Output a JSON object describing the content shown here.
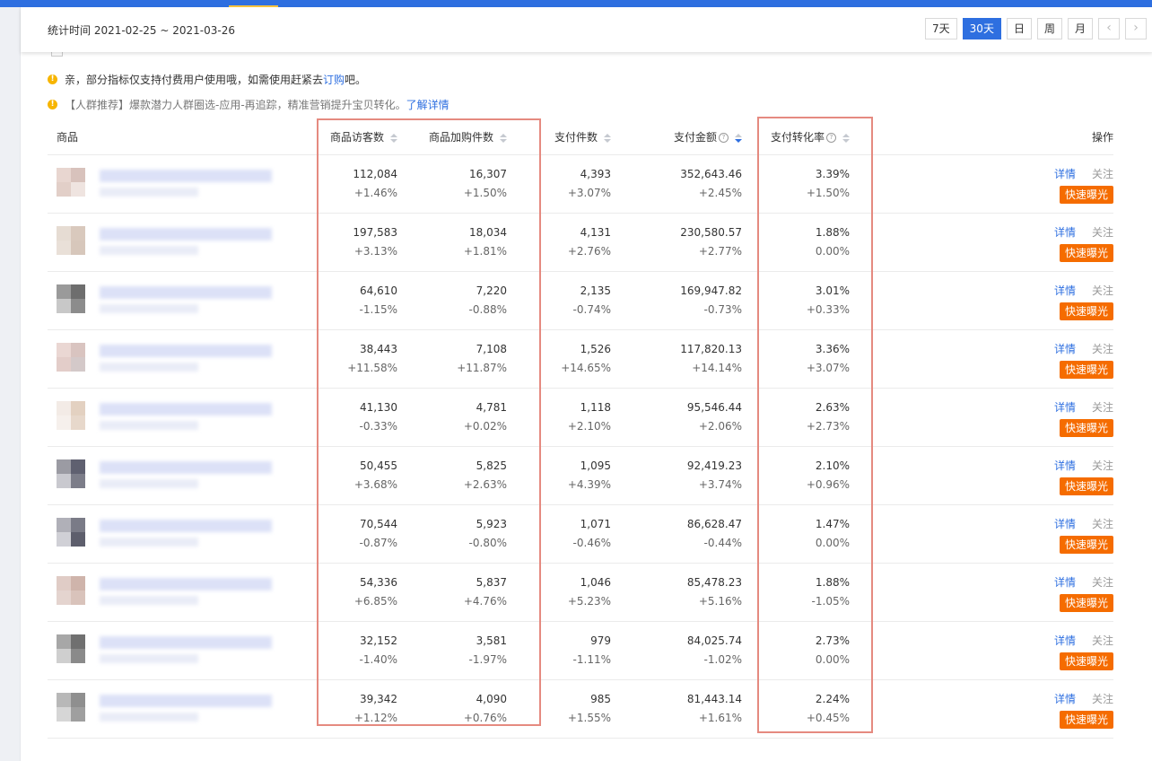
{
  "header": {
    "date_range_label": "统计时间 2021-02-25 ~ 2021-03-26",
    "periods": [
      "7天",
      "30天",
      "日",
      "周",
      "月"
    ],
    "active_period": "30天",
    "prev_icon": "chevron-left-icon",
    "next_icon": "chevron-right-icon"
  },
  "notices": [
    {
      "text": "亲，部分指标仅支持付费用户使用哦，如需使用赶紧去",
      "link": "订购",
      "suffix": "吧。"
    },
    {
      "text": "【人群推荐】爆款潜力人群圈选-应用-再追踪，精准营销提升宝贝转化。",
      "link": "了解详情",
      "suffix": ""
    }
  ],
  "table": {
    "columns": {
      "product": "商品",
      "visitors": "商品访客数",
      "cart": "商品加购件数",
      "paid_qty": "支付件数",
      "paid_amount": "支付金额",
      "conversion": "支付转化率",
      "ops": "操作"
    },
    "actions": {
      "detail": "详情",
      "follow": "关注",
      "quick": "快速曝光"
    },
    "rows": [
      {
        "visitors": "112,084",
        "visitors_chg": "+1.46%",
        "cart": "16,307",
        "cart_chg": "+1.50%",
        "paid_qty": "4,393",
        "paid_qty_chg": "+3.07%",
        "paid_amount": "352,643.46",
        "paid_amount_chg": "+2.45%",
        "conversion": "3.39%",
        "conversion_chg": "+1.50%"
      },
      {
        "visitors": "197,583",
        "visitors_chg": "+3.13%",
        "cart": "18,034",
        "cart_chg": "+1.81%",
        "paid_qty": "4,131",
        "paid_qty_chg": "+2.76%",
        "paid_amount": "230,580.57",
        "paid_amount_chg": "+2.77%",
        "conversion": "1.88%",
        "conversion_chg": "0.00%"
      },
      {
        "visitors": "64,610",
        "visitors_chg": "-1.15%",
        "cart": "7,220",
        "cart_chg": "-0.88%",
        "paid_qty": "2,135",
        "paid_qty_chg": "-0.74%",
        "paid_amount": "169,947.82",
        "paid_amount_chg": "-0.73%",
        "conversion": "3.01%",
        "conversion_chg": "+0.33%"
      },
      {
        "visitors": "38,443",
        "visitors_chg": "+11.58%",
        "cart": "7,108",
        "cart_chg": "+11.87%",
        "paid_qty": "1,526",
        "paid_qty_chg": "+14.65%",
        "paid_amount": "117,820.13",
        "paid_amount_chg": "+14.14%",
        "conversion": "3.36%",
        "conversion_chg": "+3.07%"
      },
      {
        "visitors": "41,130",
        "visitors_chg": "-0.33%",
        "cart": "4,781",
        "cart_chg": "+0.02%",
        "paid_qty": "1,118",
        "paid_qty_chg": "+2.10%",
        "paid_amount": "95,546.44",
        "paid_amount_chg": "+2.06%",
        "conversion": "2.63%",
        "conversion_chg": "+2.73%"
      },
      {
        "visitors": "50,455",
        "visitors_chg": "+3.68%",
        "cart": "5,825",
        "cart_chg": "+2.63%",
        "paid_qty": "1,095",
        "paid_qty_chg": "+4.39%",
        "paid_amount": "92,419.23",
        "paid_amount_chg": "+3.74%",
        "conversion": "2.10%",
        "conversion_chg": "+0.96%"
      },
      {
        "visitors": "70,544",
        "visitors_chg": "-0.87%",
        "cart": "5,923",
        "cart_chg": "-0.80%",
        "paid_qty": "1,071",
        "paid_qty_chg": "-0.46%",
        "paid_amount": "86,628.47",
        "paid_amount_chg": "-0.44%",
        "conversion": "1.47%",
        "conversion_chg": "0.00%"
      },
      {
        "visitors": "54,336",
        "visitors_chg": "+6.85%",
        "cart": "5,837",
        "cart_chg": "+4.76%",
        "paid_qty": "1,046",
        "paid_qty_chg": "+5.23%",
        "paid_amount": "85,478.23",
        "paid_amount_chg": "+5.16%",
        "conversion": "1.88%",
        "conversion_chg": "-1.05%"
      },
      {
        "visitors": "32,152",
        "visitors_chg": "-1.40%",
        "cart": "3,581",
        "cart_chg": "-1.97%",
        "paid_qty": "979",
        "paid_qty_chg": "-1.11%",
        "paid_amount": "84,025.74",
        "paid_amount_chg": "-1.02%",
        "conversion": "2.73%",
        "conversion_chg": "0.00%"
      },
      {
        "visitors": "39,342",
        "visitors_chg": "+1.12%",
        "cart": "4,090",
        "cart_chg": "+0.76%",
        "paid_qty": "985",
        "paid_qty_chg": "+1.55%",
        "paid_amount": "81,443.14",
        "paid_amount_chg": "+1.61%",
        "conversion": "2.24%",
        "conversion_chg": "+0.45%"
      }
    ]
  },
  "colors": {
    "accent": "#2e6fe0",
    "quick_button": "#f56c00",
    "highlight_box": "#e58a80",
    "notice_dot": "#f7b500"
  }
}
